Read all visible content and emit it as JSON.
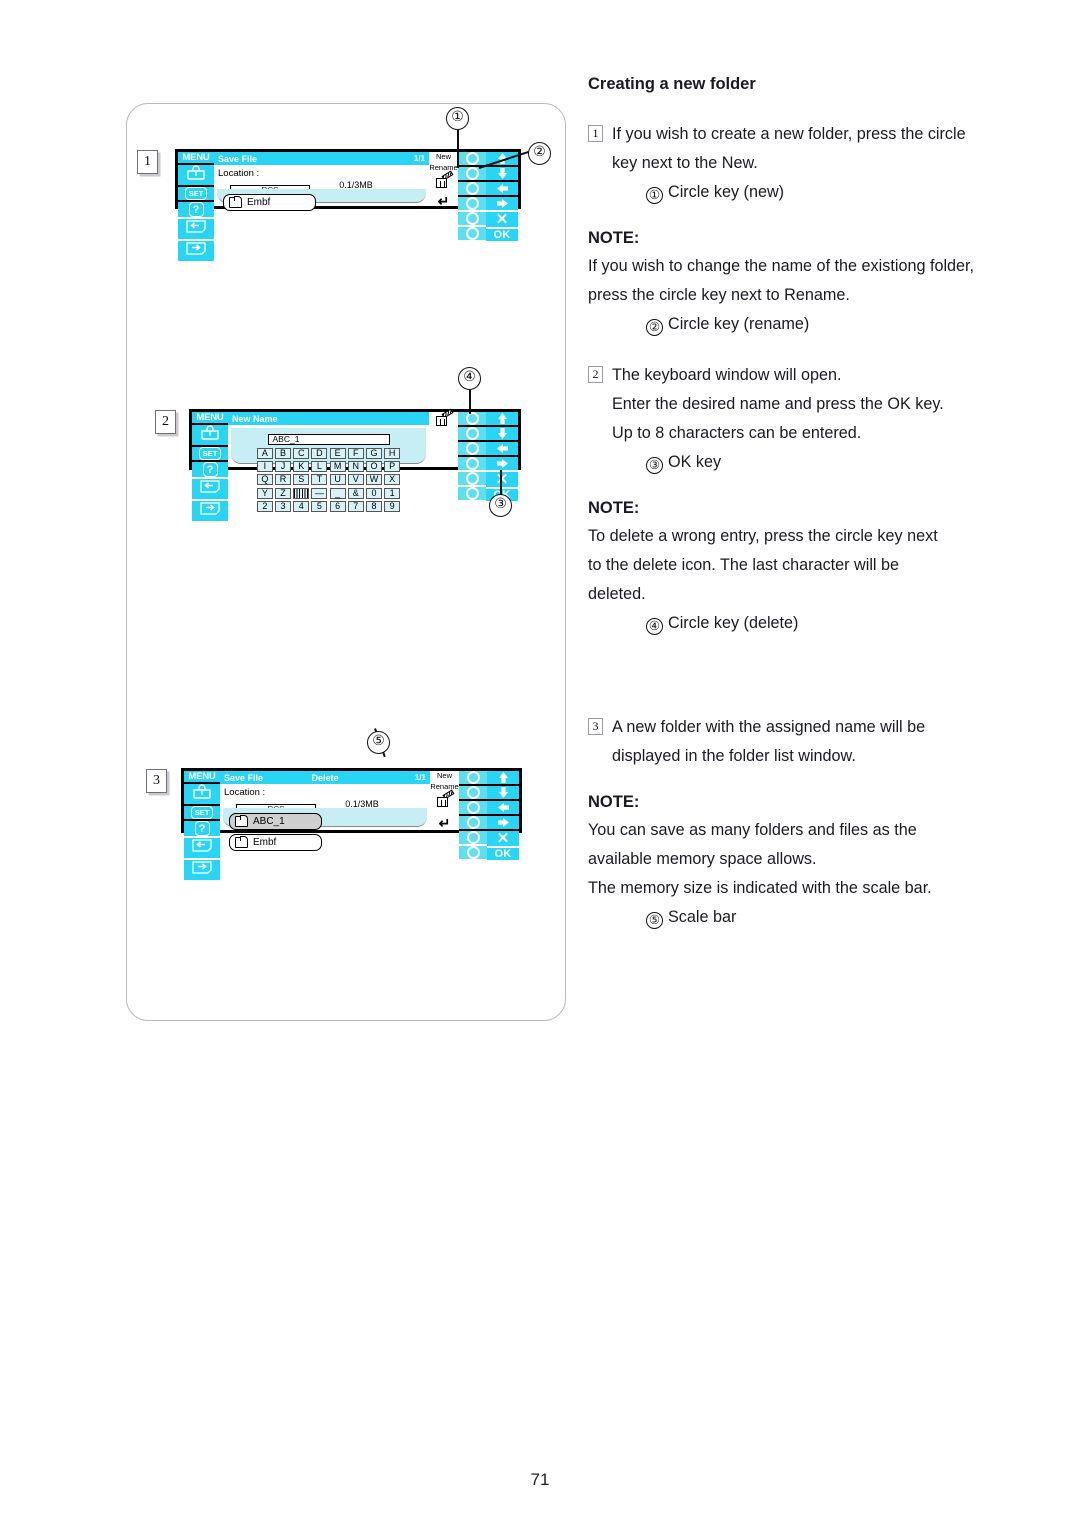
{
  "page": {
    "number": "71"
  },
  "article": {
    "title": "Creating a new folder",
    "blocks": [
      {
        "step": "1",
        "lines": [
          "If you wish to create a new folder, press the circle",
          "key next to the New."
        ],
        "sub": [
          {
            "marker": "①",
            "text": "Circle key (new)"
          }
        ]
      },
      {
        "note_label": "NOTE:",
        "lines": [
          "If you wish to change the name of the existiong folder,",
          "press the circle key next to Rename."
        ],
        "sub": [
          {
            "marker": "②",
            "text": "Circle key (rename)"
          }
        ]
      },
      {
        "step": "2",
        "lines": [
          "The keyboard window will open.",
          "Enter the desired name and press the OK key.",
          "Up to 8 characters can be entered."
        ],
        "sub": [
          {
            "marker": "③",
            "text": "OK key"
          }
        ]
      },
      {
        "note_label": "NOTE:",
        "lines": [
          "To delete a wrong entry, press the circle key next",
          "to the delete icon. The last character will be",
          "deleted."
        ],
        "sub": [
          {
            "marker": "④",
            "text": "Circle key (delete)"
          }
        ]
      },
      {
        "step": "3",
        "lines": [
          "A new folder with the assigned name will be",
          "displayed in the folder list window."
        ],
        "sub": []
      },
      {
        "note_label": "NOTE:",
        "lines": [
          "You can save as many folders and files as the",
          "available memory space allows.",
          "The memory size is indicated with the scale bar."
        ],
        "sub": [
          {
            "marker": "⑤",
            "text": "Scale bar"
          }
        ]
      }
    ]
  },
  "colors": {
    "key_cyan": "#29d5f5",
    "circle_cyan": "#5ce0f0",
    "list_bg": "#c7eef5",
    "selected_folder": "#cfcfcf"
  },
  "sidebar": {
    "items": [
      {
        "name": "menu",
        "label": "MENU"
      },
      {
        "name": "bag",
        "label": ""
      },
      {
        "name": "set",
        "label": "SET"
      },
      {
        "name": "help",
        "label": "?"
      },
      {
        "name": "page-back",
        "label": ""
      },
      {
        "name": "page-forward",
        "label": ""
      }
    ]
  },
  "right_keys": {
    "labels_screen1": [
      "New",
      "Rename",
      "delete-icon",
      "",
      "",
      "return-icon"
    ],
    "arrows": [
      "▲",
      "▼",
      "◀",
      "▶",
      "✕",
      "OK"
    ]
  },
  "screens": [
    {
      "step_box": "1",
      "title_left": "Save File",
      "title_center": "",
      "title_right": "1/1",
      "location_label": "Location :",
      "location_value": "RCS",
      "memory_text": "0.1/3MB",
      "memory_fill_percent": 3,
      "folders": [
        {
          "name": "Embf",
          "selected": false
        }
      ]
    },
    {
      "step_box": "2",
      "title_left": "New Name",
      "input_value": "ABC_1",
      "keyboard_rows": [
        [
          "A",
          "B",
          "C",
          "D",
          "E",
          "F",
          "G",
          "H"
        ],
        [
          "I",
          "J",
          "K",
          "L",
          "M",
          "N",
          "O",
          "P"
        ],
        [
          "Q",
          "R",
          "S",
          "T",
          "U",
          "V",
          "W",
          "X"
        ],
        [
          "Y",
          "Z",
          "░",
          "—",
          "_",
          "&",
          "0",
          "1"
        ],
        [
          "2",
          "3",
          "4",
          "5",
          "6",
          "7",
          "8",
          "9"
        ]
      ]
    },
    {
      "step_box": "3",
      "title_left": "Save File",
      "title_center": "Delete",
      "title_right": "1/1",
      "location_label": "Location :",
      "location_value": "RCS",
      "memory_text": "0.1/3MB",
      "memory_fill_percent": 3,
      "folders": [
        {
          "name": "ABC_1",
          "selected": true
        },
        {
          "name": "Embf",
          "selected": false
        }
      ]
    }
  ],
  "callouts": [
    {
      "marker": "①",
      "target": "circle-key-new"
    },
    {
      "marker": "②",
      "target": "circle-key-rename"
    },
    {
      "marker": "③",
      "target": "ok-key"
    },
    {
      "marker": "④",
      "target": "circle-key-delete"
    },
    {
      "marker": "⑤",
      "target": "scale-bar"
    }
  ]
}
